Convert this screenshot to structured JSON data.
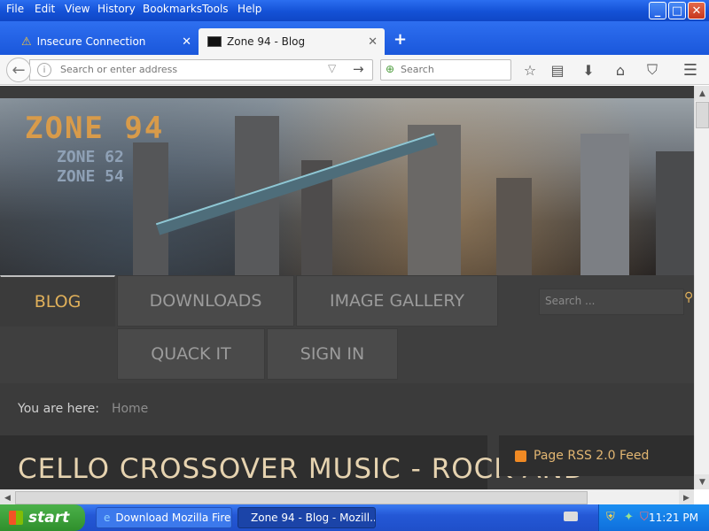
{
  "window": {
    "menus": [
      "File",
      "Edit",
      "View",
      "History",
      "Bookmarks",
      "Tools",
      "Help"
    ],
    "buttons": {
      "minimize": "_",
      "maximize": "□",
      "close": "✕"
    }
  },
  "tabs": [
    {
      "label": "Insecure Connection",
      "icon": "warning-icon"
    },
    {
      "label": "Zone 94 - Blog",
      "icon": "site-favicon"
    }
  ],
  "toolbar": {
    "address_placeholder": "Search or enter address",
    "search_placeholder": "Search",
    "new_tab": "+",
    "icons": [
      "bookmark-star-icon",
      "reading-list-icon",
      "download-icon",
      "home-icon",
      "pocket-icon",
      "menu-icon"
    ]
  },
  "banner": {
    "logo_main": "ZONE 94",
    "logo_sub1": "ZONE 62",
    "logo_sub2": "ZONE 54"
  },
  "site_nav": {
    "items": [
      "BLOG",
      "DOWNLOADS",
      "IMAGE GALLERY",
      "QUACK IT",
      "SIGN IN"
    ],
    "active": "BLOG",
    "search_placeholder": "Search ..."
  },
  "breadcrumb": {
    "prefix": "You are here:",
    "current": "Home"
  },
  "article": {
    "title": "CELLO CROSSOVER MUSIC - ROCK AND"
  },
  "sidebar": {
    "rss_label": "Page RSS 2.0 Feed"
  },
  "taskbar": {
    "start": "start",
    "items": [
      "Download Mozilla Fire...",
      "Zone 94 - Blog - Mozill..."
    ],
    "clock": "11:21 PM"
  },
  "colors": {
    "accent": "#e0b05a",
    "xp_blue": "#1f57d6",
    "start_green": "#3a9d37"
  }
}
